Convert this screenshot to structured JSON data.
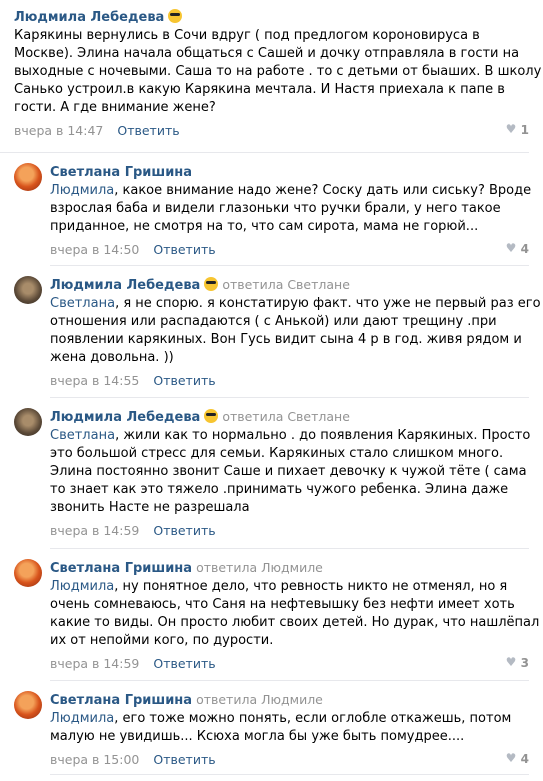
{
  "comments": [
    {
      "author": "Людмила Лебедева",
      "reply_to": "",
      "text_lines": [
        "Карякины вернулись в Сочи вдруг ( под предлогом короновируса в",
        "Москве). Элина начала общаться с Сашей и дочку отправляла в гости на",
        "выходные с ночевыми. Саша то на работе . то с детьми от быаших. В школу",
        "Санько устроил.в какую Карякина мечтала. И Настя приехала к папе в",
        "гости. А где внимание жене?"
      ],
      "time": "вчера в 14:47",
      "reply_label": "Ответить",
      "likes": "1"
    },
    {
      "author": "Светлана Гришина",
      "reply_to": "",
      "mention": "Людмила",
      "text_lines": [
        ", какое внимание надо жене? Соску дать или сиську? Вроде",
        "взрослая баба и видели глазоньки что ручки брали, у него такое",
        "приданное, не смотря на то, что сам сирота, мама не горюй..."
      ],
      "time": "вчера в 14:50",
      "reply_label": "Ответить",
      "likes": "4"
    },
    {
      "author": "Людмила Лебедева",
      "reply_to": "ответила Светлане",
      "mention": "Светлана",
      "text_lines": [
        ", я не спорю. я констатирую факт. что уже не первый раз его",
        "отношения или распадаются ( с Анькой) или дают трещину .при",
        "появлении карякиных. Вон Гусь видит сына 4 р в год. живя рядом и",
        "жена довольна. ))"
      ],
      "time": "вчера в 14:55",
      "reply_label": "Ответить",
      "likes": ""
    },
    {
      "author": "Людмила Лебедева",
      "reply_to": "ответила Светлане",
      "mention": "Светлана",
      "text_lines": [
        ", жили как то нормально . до появления Карякиных. Просто",
        "это большой стресс для семьи. Карякиных стало слишком много.",
        "Элина постоянно звонит Саше и пихает девочку к чужой тёте ( сама",
        "то знает как это тяжело .принимать чужого ребенка. Элина даже",
        "звонить Насте не разрешала"
      ],
      "time": "вчера в 14:59",
      "reply_label": "Ответить",
      "likes": ""
    },
    {
      "author": "Светлана Гришина",
      "reply_to": "ответила Людмиле",
      "mention": "Людмила",
      "text_lines": [
        ", ну понятное дело, что ревность никто не отменял, но я",
        "очень сомневаюсь, что Саня на нефтевышку без нефти имеет хоть",
        "какие то виды. Он просто любит своих детей. Но дурак, что нашлёпал",
        "их от непойми кого, по дурости."
      ],
      "time": "вчера в 14:59",
      "reply_label": "Ответить",
      "likes": "3"
    },
    {
      "author": "Светлана Гришина",
      "reply_to": "ответила Людмиле",
      "mention": "Людмила",
      "text_lines": [
        ", его тоже можно понять, если оглобле откажешь, потом",
        "малую не увидишь... Ксюха могла бы уже быть помудрее...."
      ],
      "time": "вчера в 15:00",
      "reply_label": "Ответить",
      "likes": "4"
    }
  ]
}
